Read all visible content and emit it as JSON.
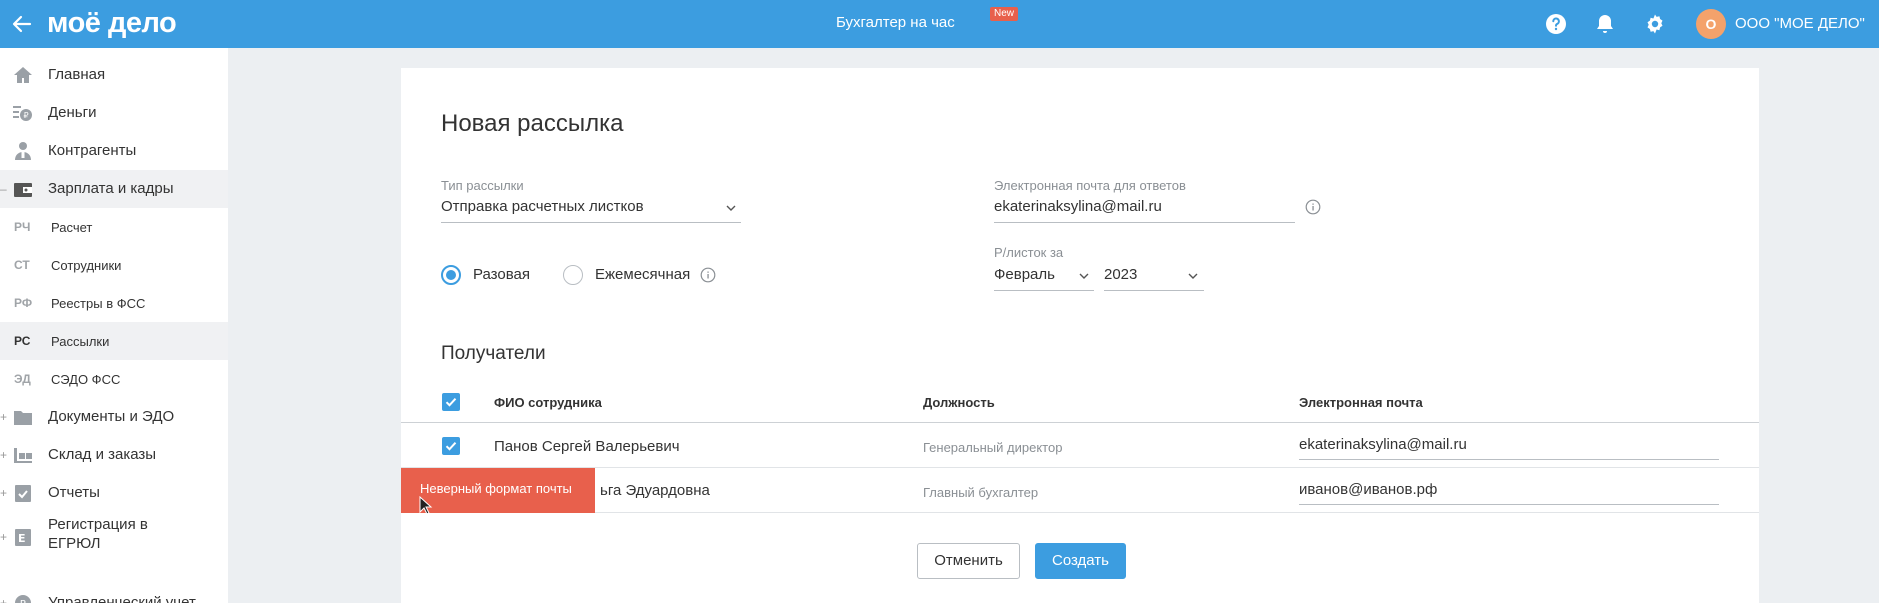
{
  "header": {
    "logo_text": "моё дело",
    "center_title": "Бухгалтер на час",
    "new_badge": "New",
    "org_initial": "О",
    "org_name": "ООО \"МОЕ ДЕЛО\"",
    "icons": [
      "back-arrow-icon",
      "help-icon",
      "bell-icon",
      "gear-icon"
    ]
  },
  "sidebar": {
    "items": [
      {
        "label": "Главная",
        "icon": "home-icon",
        "expander": ""
      },
      {
        "label": "Деньги",
        "icon": "money-icon",
        "expander": ""
      },
      {
        "label": "Контрагенты",
        "icon": "contractors-icon",
        "expander": ""
      },
      {
        "label": "Зарплата и кадры",
        "icon": "wallet-icon",
        "expander": "–"
      },
      {
        "label": "Документы и ЭДО",
        "icon": "folder-icon",
        "expander": "+"
      },
      {
        "label": "Склад и заказы",
        "icon": "warehouse-icon",
        "expander": "+"
      },
      {
        "label": "Отчеты",
        "icon": "reports-icon",
        "expander": "+"
      },
      {
        "label": "Регистрация в ЕГРЮЛ",
        "icon": "registration-icon",
        "expander": "+"
      },
      {
        "label": "Управленческий учет",
        "icon": "management-icon",
        "expander": "+"
      }
    ],
    "subitems": [
      {
        "abbr": "РЧ",
        "label": "Расчет"
      },
      {
        "abbr": "СТ",
        "label": "Сотрудники"
      },
      {
        "abbr": "РФ",
        "label": "Реестры в ФСС"
      },
      {
        "abbr": "РС",
        "label": "Рассылки"
      },
      {
        "abbr": "ЭД",
        "label": "СЭДО ФСС"
      }
    ]
  },
  "form": {
    "title": "Новая рассылка",
    "type_label": "Тип рассылки",
    "type_value": "Отправка расчетных листков",
    "reply_email_label": "Электронная почта для ответов",
    "reply_email_value": "ekaterinaksylina@mail.ru",
    "radio_once": "Разовая",
    "radio_monthly": "Ежемесячная",
    "selected_radio": "Разовая",
    "period_label": "Р/листок за",
    "month": "Февраль",
    "year": "2023"
  },
  "recipients": {
    "title": "Получатели",
    "columns": [
      "ФИО сотрудника",
      "Должность",
      "Электронная почта"
    ],
    "rows": [
      {
        "name": "Панов Сергей Валерьевич",
        "position": "Генеральный директор",
        "email": "ekaterinaksylina@mail.ru",
        "checked": true
      },
      {
        "name": "ьга Эдуардовна",
        "position": "Главный бухгалтер",
        "email": "иванов@иванов.рф",
        "checked": true
      }
    ],
    "error_tooltip": "Неверный формат почты"
  },
  "buttons": {
    "cancel": "Отменить",
    "create": "Создать"
  },
  "colors": {
    "primary": "#3c9de0",
    "error": "#e8604c",
    "avatar": "#f4a26b"
  }
}
